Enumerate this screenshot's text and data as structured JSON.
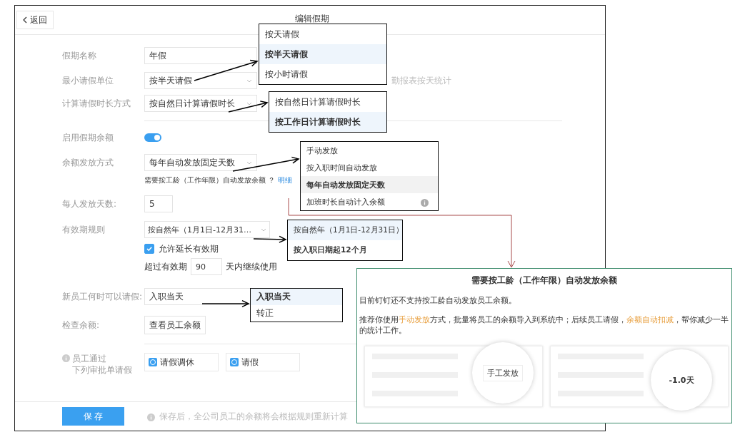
{
  "header": {
    "back_label": "返回",
    "title": "编辑假期"
  },
  "sections": [
    {
      "fields": [
        {
          "kind": "input",
          "label": "假期名称",
          "value": "年假"
        },
        {
          "kind": "select",
          "label": "最小请假单位",
          "value": "按半天请假",
          "note": "勤报表按天统计"
        },
        {
          "kind": "select",
          "label": "计算请假时长方式",
          "value": "按自然日计算请假时长"
        }
      ]
    },
    {
      "fields": [
        {
          "kind": "toggle",
          "label": "启用假期余额",
          "on": true
        },
        {
          "kind": "select",
          "label": "余额发放方式",
          "value": "每年自动发放固定天数"
        },
        {
          "kind": "hint",
          "text": "需要按工龄（工作年限）自动发放余额 ？",
          "link": "明细"
        },
        {
          "kind": "number",
          "label": "每人发放天数:",
          "value": "5"
        },
        {
          "kind": "select",
          "label": "有效期规则",
          "value": "按自然年（1月1日-12月31…"
        },
        {
          "kind": "checkbox",
          "label": "允许延长有效期",
          "checked": true
        },
        {
          "kind": "extend",
          "before": "超过有效期",
          "value": "90",
          "after": "天内继续使用"
        },
        {
          "kind": "plain",
          "label": "新员工何时可以请假:",
          "value": "入职当天"
        },
        {
          "kind": "button",
          "label": "检查余额:",
          "value": "查看员工余额"
        }
      ]
    },
    {
      "fields": [
        {
          "kind": "tags",
          "label_lines": [
            "员工通过",
            "下列审批单请假"
          ],
          "tags": [
            {
              "label": "请假调休",
              "checked": true
            },
            {
              "label": "请假",
              "checked": true
            }
          ]
        }
      ]
    }
  ],
  "footer": {
    "save": "保 存",
    "note": "保存后，全公司员工的余额将会根据规则重新计算"
  },
  "popups": [
    {
      "items": [
        {
          "label": "按天请假",
          "selected": false
        },
        {
          "label": "按半天请假",
          "selected": true
        },
        {
          "label": "按小时请假",
          "selected": false
        }
      ]
    },
    {
      "items": [
        {
          "label": "按自然日计算请假时长",
          "selected": false
        },
        {
          "label": "按工作日计算请假时长",
          "selected": true
        }
      ]
    },
    {
      "items": [
        {
          "label": "手动发放",
          "selected": false
        },
        {
          "label": "按入职时间自动发放",
          "selected": false
        },
        {
          "label": "每年自动发放固定天数",
          "selected": true
        },
        {
          "label": "加班时长自动计入余额",
          "selected": false,
          "info": true
        }
      ]
    },
    {
      "items": [
        {
          "label": "按自然年（1月1日-12月31日）",
          "selected": false
        },
        {
          "label": "按入职日期起12个月",
          "selected": true
        }
      ]
    },
    {
      "items": [
        {
          "label": "入职当天",
          "selected": true
        },
        {
          "label": "转正",
          "selected": false
        }
      ]
    }
  ],
  "info_panel": {
    "title": "需要按工龄（工作年限）自动发放余额",
    "paragraph_1": "目前钉钉还不支持按工龄自动发放员工余额。",
    "paragraph_2": [
      {
        "text": "推荐你使用",
        "highlight": false
      },
      {
        "text": "手动发放",
        "highlight": true
      },
      {
        "text": "方式，批量将员工的余额导入到系统中；后续员工请假，",
        "highlight": false
      },
      {
        "text": "余额自动扣减",
        "highlight": true
      },
      {
        "text": "，帮你减少一半的统计工作。",
        "highlight": false
      }
    ],
    "zoom_labels": [
      "手工发放",
      "-1.0天"
    ]
  }
}
